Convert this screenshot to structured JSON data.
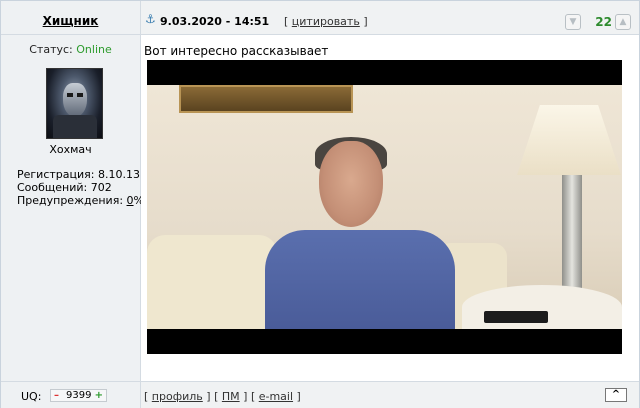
{
  "post": {
    "author": "Хищник",
    "date": "9.03.2020 - 14:51",
    "quote_label": "цитировать",
    "bracket_open": "[",
    "bracket_close": "]",
    "rating": "22",
    "message": "Вот интересно рассказывает"
  },
  "profile": {
    "status_label": "Статус:",
    "status_value": "Online",
    "status_color": "#2d9b2d",
    "rank": "Хохмач",
    "registration_label": "Регистрация:",
    "registration_value": "8.10.13",
    "messages_label": "Сообщений:",
    "messages_value": "702",
    "warnings_label": "Предупреждения:",
    "warnings_value": "0",
    "warnings_suffix": "%"
  },
  "footer": {
    "uq_label": "UQ:",
    "uq_value": "9399",
    "uq_minus": "–",
    "uq_plus": "+",
    "profile_link": "профиль",
    "pm_link": "ПМ",
    "email_link": "e-mail",
    "top_button": "^"
  },
  "icons": {
    "post_anchor": "anchor-icon",
    "vote_down": "thumb-down-icon",
    "vote_up": "thumb-up-icon"
  },
  "colors": {
    "rating": "#2e8b2e",
    "anchor": "#3d7fb0",
    "panel_bg": "#eef1f3"
  }
}
